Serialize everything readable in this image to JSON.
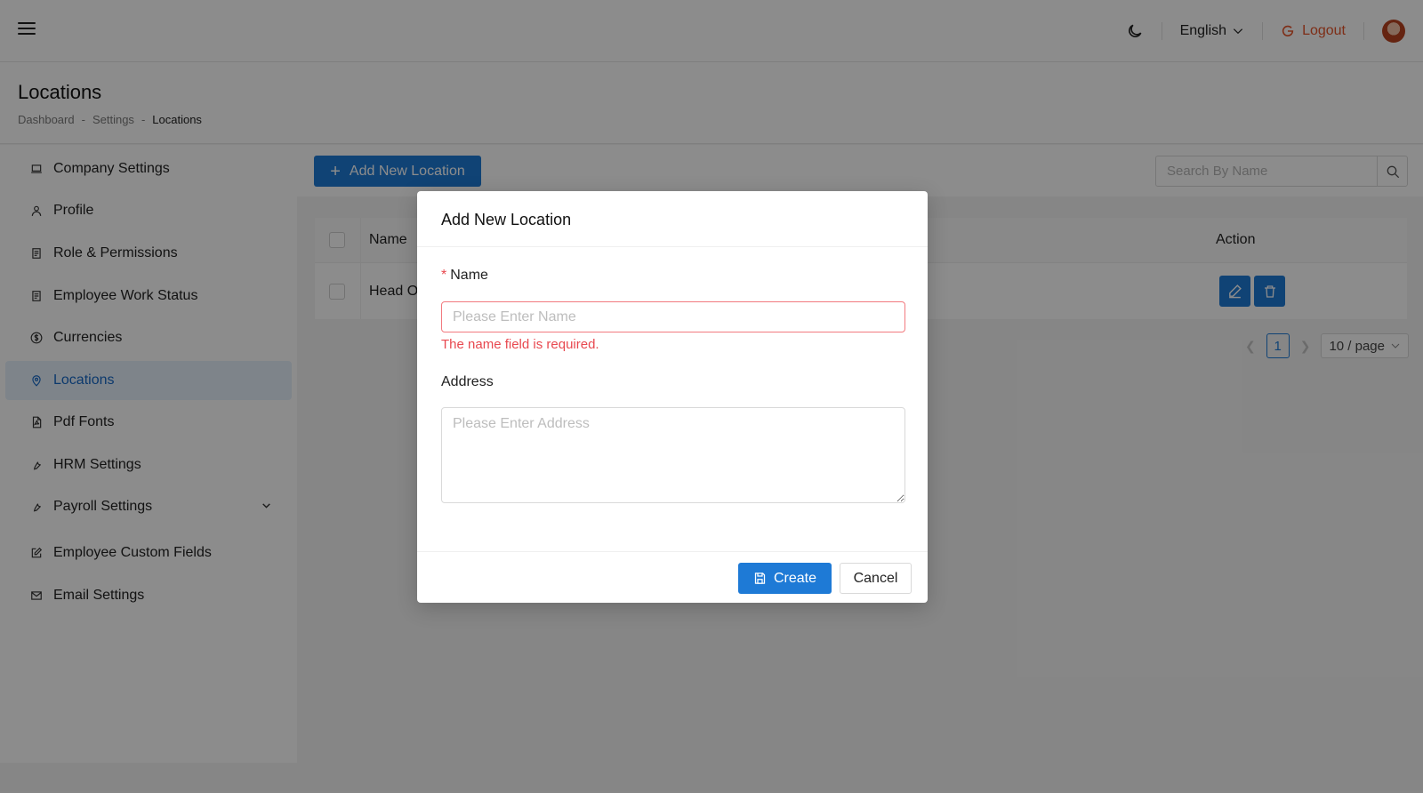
{
  "header": {
    "menu_icon": "hamburger-icon",
    "theme_icon": "moon-icon",
    "language": "English",
    "logout_label": "Logout"
  },
  "page": {
    "title": "Locations",
    "breadcrumb": [
      "Dashboard",
      "Settings",
      "Locations"
    ],
    "breadcrumb_sep": "-"
  },
  "sidebar": {
    "items": [
      {
        "label": "Company Settings",
        "icon": "laptop-icon"
      },
      {
        "label": "Profile",
        "icon": "user-icon"
      },
      {
        "label": "Role & Permissions",
        "icon": "document-icon"
      },
      {
        "label": "Employee Work Status",
        "icon": "document-icon"
      },
      {
        "label": "Currencies",
        "icon": "dollar-icon"
      },
      {
        "label": "Locations",
        "icon": "location-icon",
        "active": true
      },
      {
        "label": "Pdf Fonts",
        "icon": "pdf-icon"
      },
      {
        "label": "HRM Settings",
        "icon": "tool-icon"
      },
      {
        "label": "Payroll Settings",
        "icon": "tool-icon",
        "expandable": true
      },
      {
        "label": "Employee Custom Fields",
        "icon": "edit-icon"
      },
      {
        "label": "Email Settings",
        "icon": "mail-icon"
      }
    ]
  },
  "toolbar": {
    "add_label": "Add New Location",
    "search_placeholder": "Search By Name"
  },
  "table": {
    "columns": [
      "Name",
      "Action"
    ],
    "rows": [
      {
        "name": "Head O"
      }
    ]
  },
  "pagination": {
    "current": "1",
    "page_size": "10 / page"
  },
  "modal": {
    "title": "Add New Location",
    "name_label": "Name",
    "name_placeholder": "Please Enter Name",
    "name_error": "The name field is required.",
    "address_label": "Address",
    "address_placeholder": "Please Enter Address",
    "create_label": "Create",
    "cancel_label": "Cancel"
  },
  "colors": {
    "primary": "#1e7ad6",
    "error": "#e8484f",
    "logout": "#e5542b",
    "active_bg": "#e6f1fc"
  }
}
